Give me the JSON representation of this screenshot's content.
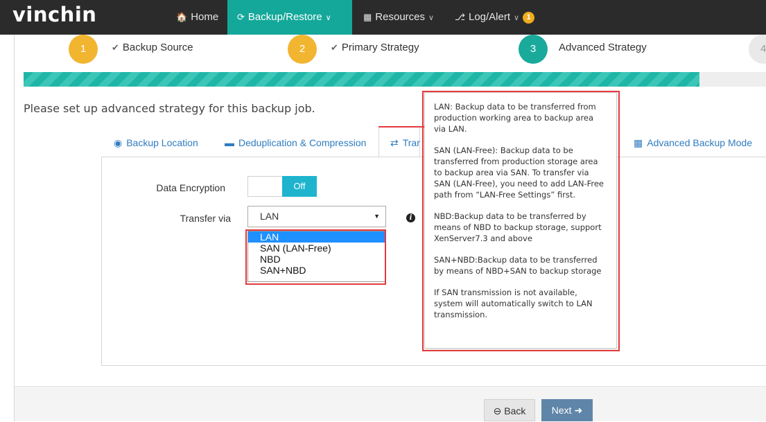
{
  "app": {
    "logo": "vinchin"
  },
  "nav": {
    "home": {
      "icon": "home-icon",
      "label": "Home"
    },
    "backup_restore": {
      "icon": "refresh-icon",
      "label": "Backup/Restore"
    },
    "resources": {
      "icon": "grid-icon",
      "label": "Resources"
    },
    "log_alert": {
      "icon": "bell-icon",
      "label": "Log/Alert",
      "badge": "1"
    },
    "accent_color": "#14a89a"
  },
  "steps": [
    {
      "number": "1",
      "label": "Backup Source",
      "status": "done"
    },
    {
      "number": "2",
      "label": "Primary Strategy",
      "status": "done"
    },
    {
      "number": "3",
      "label": "Advanced Strategy",
      "status": "current"
    },
    {
      "number": "4",
      "label": "",
      "status": "todo"
    }
  ],
  "progress": {
    "fraction": 0.91
  },
  "intro_text": "Please set up advanced strategy for this backup job.",
  "tabs": [
    {
      "icon": "location-pin-icon",
      "label": "Backup Location"
    },
    {
      "icon": "database-icon",
      "label": "Deduplication & Compression"
    },
    {
      "icon": "transfer-arrows-icon",
      "label": "Trar"
    },
    {
      "icon": "grid-icon",
      "label": "Advanced Backup Mode"
    }
  ],
  "form": {
    "encryption_label": "Data Encryption",
    "encryption_state": "Off",
    "transfer_label": "Transfer via",
    "transfer_value": "LAN",
    "transfer_options": [
      "LAN",
      "SAN (LAN-Free)",
      "NBD",
      "SAN+NBD"
    ]
  },
  "tooltip": {
    "paragraphs": [
      "LAN: Backup data to be transferred from production working area to backup area via LAN.",
      "SAN (LAN-Free): Backup data to be transferred from production storage area to backup area via SAN. To transfer via SAN (LAN-Free), you need to add LAN-Free path from “LAN-Free Settings” first.",
      "NBD:Backup data to be transferred by means of NBD to backup storage, support XenServer7.3 and above",
      "SAN+NBD:Backup data to be transferred by means of NBD+SAN to backup storage",
      "If SAN transmission is not available, system will automatically switch to LAN transmission."
    ]
  },
  "footer": {
    "back_label": "Back",
    "next_label": "Next"
  },
  "highlight_color": "#e4393c"
}
